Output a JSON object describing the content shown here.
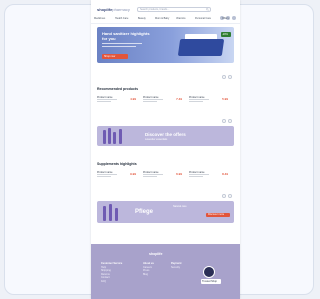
{
  "header": {
    "logo_main": "shoplife",
    "logo_sub": "pharmacy",
    "search_placeholder": "Search products, brands..."
  },
  "nav": {
    "items": [
      "Medicines",
      "Health Care",
      "Beauty",
      "Mom & Baby",
      "Vitamins",
      "Personal Care",
      "Offers"
    ]
  },
  "hero": {
    "line1": "Hand sanitizer highlights",
    "line2": "for you",
    "cta": "Shop now",
    "badge": "-20%"
  },
  "section_recommended": {
    "title": "Recommended products",
    "products": [
      {
        "name": "Product name",
        "price": "4.99"
      },
      {
        "name": "Product name",
        "price": "7.49"
      },
      {
        "name": "Product name",
        "price": "5.99"
      }
    ]
  },
  "promo1": {
    "title": "Discover the offers",
    "subtitle": "Lavender essentials"
  },
  "section_highlights": {
    "title": "Supplements highlights",
    "products": [
      {
        "name": "Product name",
        "price": "9.99"
      },
      {
        "name": "Product name",
        "price": "6.99"
      },
      {
        "name": "Product name",
        "price": "8.49"
      }
    ]
  },
  "promo2": {
    "title": "Pflege",
    "subtitle": "Natural care",
    "cta": "Discover more"
  },
  "footer": {
    "logo": "shoplife",
    "col1": [
      "Customer Service",
      "Help",
      "Shipping",
      "Returns",
      "Contact",
      "FAQ"
    ],
    "col2": [
      "About us",
      "Careers",
      "Press",
      "Blog"
    ],
    "col3": [
      "Payment",
      "Security"
    ],
    "badge": "Trusted Shop"
  }
}
